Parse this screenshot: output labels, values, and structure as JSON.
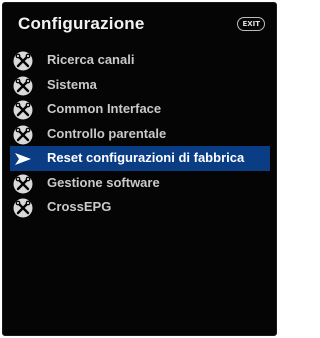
{
  "header": {
    "title": "Configurazione",
    "exit_label": "EXIT"
  },
  "menu": {
    "selected_index": 4,
    "items": [
      {
        "label": "Ricerca canali",
        "icon": "tools-icon"
      },
      {
        "label": "Sistema",
        "icon": "tools-icon"
      },
      {
        "label": "Common Interface",
        "icon": "tools-icon"
      },
      {
        "label": "Controllo parentale",
        "icon": "tools-icon"
      },
      {
        "label": "Reset configurazioni di fabbrica",
        "icon": "pointer-arrow-icon"
      },
      {
        "label": "Gestione software",
        "icon": "tools-icon"
      },
      {
        "label": "CrossEPG",
        "icon": "tools-icon"
      }
    ]
  },
  "colors": {
    "background": "#050505",
    "selection": "#0b3d84",
    "text": "#c9c9c9",
    "selected_text": "#ffffff",
    "icon": "#d9d9d9"
  }
}
